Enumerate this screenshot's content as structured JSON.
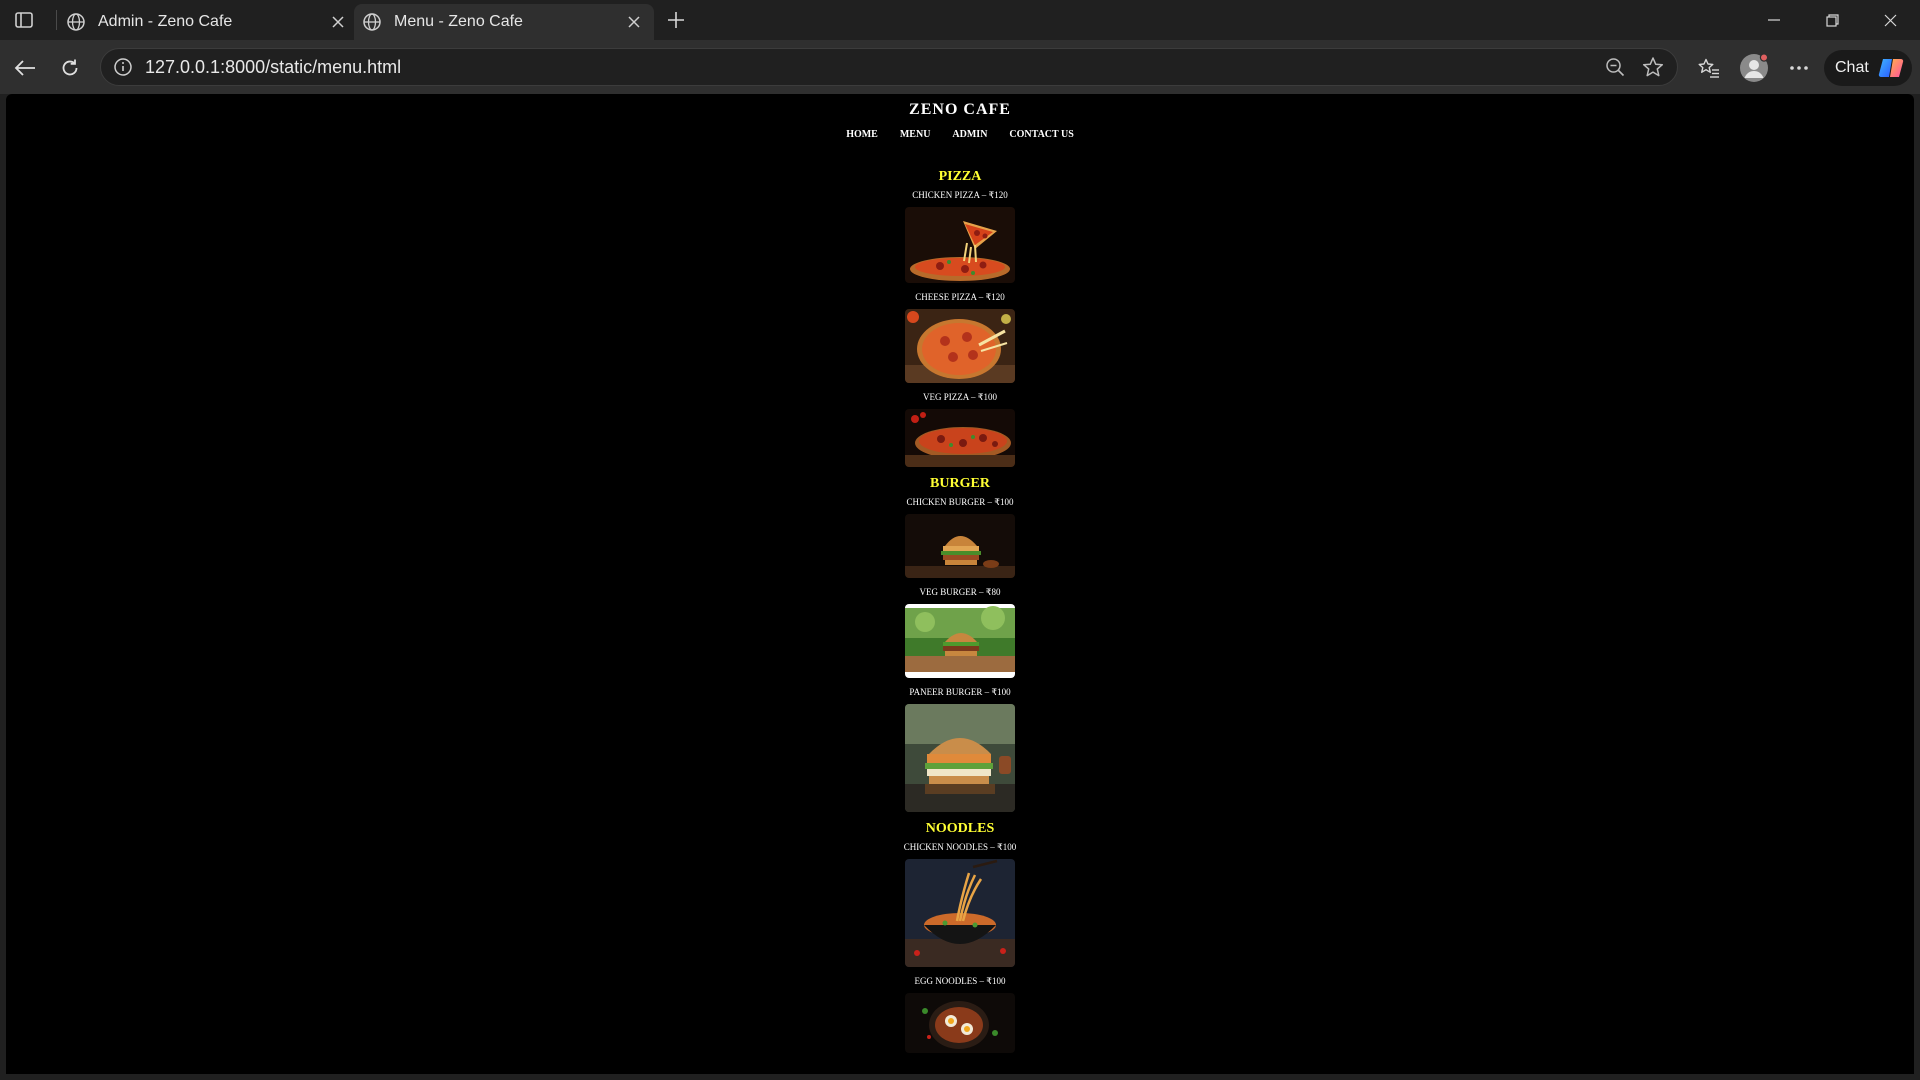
{
  "browser": {
    "tabs": [
      {
        "title": "Admin - Zeno Cafe",
        "active": false
      },
      {
        "title": "Menu - Zeno Cafe",
        "active": true
      }
    ],
    "url": "127.0.0.1:8000/static/menu.html",
    "chat_label": "Chat"
  },
  "site": {
    "title": "ZENO CAFE",
    "nav": [
      "HOME",
      "MENU",
      "ADMIN",
      "CONTACT US"
    ]
  },
  "menu": [
    {
      "category": "PIZZA",
      "items": [
        {
          "name": "CHICKEN PIZZA – ₹120",
          "image": "chicken-pizza"
        },
        {
          "name": "CHEESE PIZZA – ₹120",
          "image": "cheese-pizza"
        },
        {
          "name": "VEG PIZZA – ₹100",
          "image": "veg-pizza"
        }
      ]
    },
    {
      "category": "BURGER",
      "items": [
        {
          "name": "CHICKEN BURGER – ₹100",
          "image": "chicken-burger"
        },
        {
          "name": "VEG BURGER – ₹80",
          "image": "veg-burger"
        },
        {
          "name": "PANEER BURGER – ₹100",
          "image": "paneer-burger"
        }
      ]
    },
    {
      "category": "NOODLES",
      "items": [
        {
          "name": "CHICKEN NOODLES – ₹100",
          "image": "chicken-noodles"
        },
        {
          "name": "EGG NOODLES – ₹100",
          "image": "egg-noodles"
        }
      ]
    }
  ],
  "colors": {
    "category": "#ffff33",
    "page_background": "#000000",
    "chrome_background": "#202020"
  }
}
